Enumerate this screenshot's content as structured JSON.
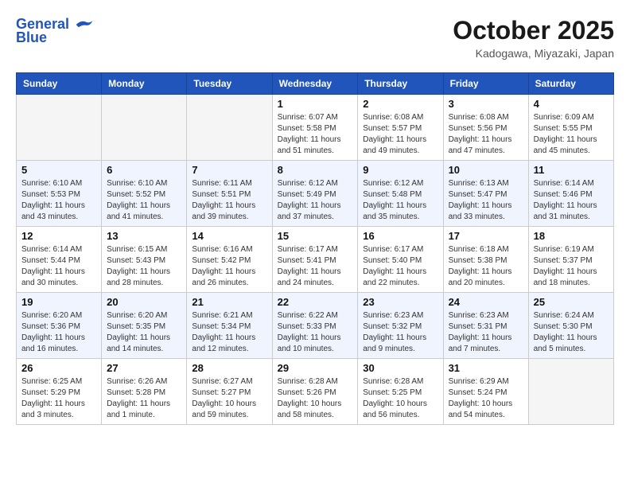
{
  "header": {
    "logo_line1": "General",
    "logo_line2": "Blue",
    "month_year": "October 2025",
    "location": "Kadogawa, Miyazaki, Japan"
  },
  "weekdays": [
    "Sunday",
    "Monday",
    "Tuesday",
    "Wednesday",
    "Thursday",
    "Friday",
    "Saturday"
  ],
  "weeks": [
    [
      {
        "day": "",
        "info": ""
      },
      {
        "day": "",
        "info": ""
      },
      {
        "day": "",
        "info": ""
      },
      {
        "day": "1",
        "info": "Sunrise: 6:07 AM\nSunset: 5:58 PM\nDaylight: 11 hours\nand 51 minutes."
      },
      {
        "day": "2",
        "info": "Sunrise: 6:08 AM\nSunset: 5:57 PM\nDaylight: 11 hours\nand 49 minutes."
      },
      {
        "day": "3",
        "info": "Sunrise: 6:08 AM\nSunset: 5:56 PM\nDaylight: 11 hours\nand 47 minutes."
      },
      {
        "day": "4",
        "info": "Sunrise: 6:09 AM\nSunset: 5:55 PM\nDaylight: 11 hours\nand 45 minutes."
      }
    ],
    [
      {
        "day": "5",
        "info": "Sunrise: 6:10 AM\nSunset: 5:53 PM\nDaylight: 11 hours\nand 43 minutes."
      },
      {
        "day": "6",
        "info": "Sunrise: 6:10 AM\nSunset: 5:52 PM\nDaylight: 11 hours\nand 41 minutes."
      },
      {
        "day": "7",
        "info": "Sunrise: 6:11 AM\nSunset: 5:51 PM\nDaylight: 11 hours\nand 39 minutes."
      },
      {
        "day": "8",
        "info": "Sunrise: 6:12 AM\nSunset: 5:49 PM\nDaylight: 11 hours\nand 37 minutes."
      },
      {
        "day": "9",
        "info": "Sunrise: 6:12 AM\nSunset: 5:48 PM\nDaylight: 11 hours\nand 35 minutes."
      },
      {
        "day": "10",
        "info": "Sunrise: 6:13 AM\nSunset: 5:47 PM\nDaylight: 11 hours\nand 33 minutes."
      },
      {
        "day": "11",
        "info": "Sunrise: 6:14 AM\nSunset: 5:46 PM\nDaylight: 11 hours\nand 31 minutes."
      }
    ],
    [
      {
        "day": "12",
        "info": "Sunrise: 6:14 AM\nSunset: 5:44 PM\nDaylight: 11 hours\nand 30 minutes."
      },
      {
        "day": "13",
        "info": "Sunrise: 6:15 AM\nSunset: 5:43 PM\nDaylight: 11 hours\nand 28 minutes."
      },
      {
        "day": "14",
        "info": "Sunrise: 6:16 AM\nSunset: 5:42 PM\nDaylight: 11 hours\nand 26 minutes."
      },
      {
        "day": "15",
        "info": "Sunrise: 6:17 AM\nSunset: 5:41 PM\nDaylight: 11 hours\nand 24 minutes."
      },
      {
        "day": "16",
        "info": "Sunrise: 6:17 AM\nSunset: 5:40 PM\nDaylight: 11 hours\nand 22 minutes."
      },
      {
        "day": "17",
        "info": "Sunrise: 6:18 AM\nSunset: 5:38 PM\nDaylight: 11 hours\nand 20 minutes."
      },
      {
        "day": "18",
        "info": "Sunrise: 6:19 AM\nSunset: 5:37 PM\nDaylight: 11 hours\nand 18 minutes."
      }
    ],
    [
      {
        "day": "19",
        "info": "Sunrise: 6:20 AM\nSunset: 5:36 PM\nDaylight: 11 hours\nand 16 minutes."
      },
      {
        "day": "20",
        "info": "Sunrise: 6:20 AM\nSunset: 5:35 PM\nDaylight: 11 hours\nand 14 minutes."
      },
      {
        "day": "21",
        "info": "Sunrise: 6:21 AM\nSunset: 5:34 PM\nDaylight: 11 hours\nand 12 minutes."
      },
      {
        "day": "22",
        "info": "Sunrise: 6:22 AM\nSunset: 5:33 PM\nDaylight: 11 hours\nand 10 minutes."
      },
      {
        "day": "23",
        "info": "Sunrise: 6:23 AM\nSunset: 5:32 PM\nDaylight: 11 hours\nand 9 minutes."
      },
      {
        "day": "24",
        "info": "Sunrise: 6:23 AM\nSunset: 5:31 PM\nDaylight: 11 hours\nand 7 minutes."
      },
      {
        "day": "25",
        "info": "Sunrise: 6:24 AM\nSunset: 5:30 PM\nDaylight: 11 hours\nand 5 minutes."
      }
    ],
    [
      {
        "day": "26",
        "info": "Sunrise: 6:25 AM\nSunset: 5:29 PM\nDaylight: 11 hours\nand 3 minutes."
      },
      {
        "day": "27",
        "info": "Sunrise: 6:26 AM\nSunset: 5:28 PM\nDaylight: 11 hours\nand 1 minute."
      },
      {
        "day": "28",
        "info": "Sunrise: 6:27 AM\nSunset: 5:27 PM\nDaylight: 10 hours\nand 59 minutes."
      },
      {
        "day": "29",
        "info": "Sunrise: 6:28 AM\nSunset: 5:26 PM\nDaylight: 10 hours\nand 58 minutes."
      },
      {
        "day": "30",
        "info": "Sunrise: 6:28 AM\nSunset: 5:25 PM\nDaylight: 10 hours\nand 56 minutes."
      },
      {
        "day": "31",
        "info": "Sunrise: 6:29 AM\nSunset: 5:24 PM\nDaylight: 10 hours\nand 54 minutes."
      },
      {
        "day": "",
        "info": ""
      }
    ]
  ]
}
